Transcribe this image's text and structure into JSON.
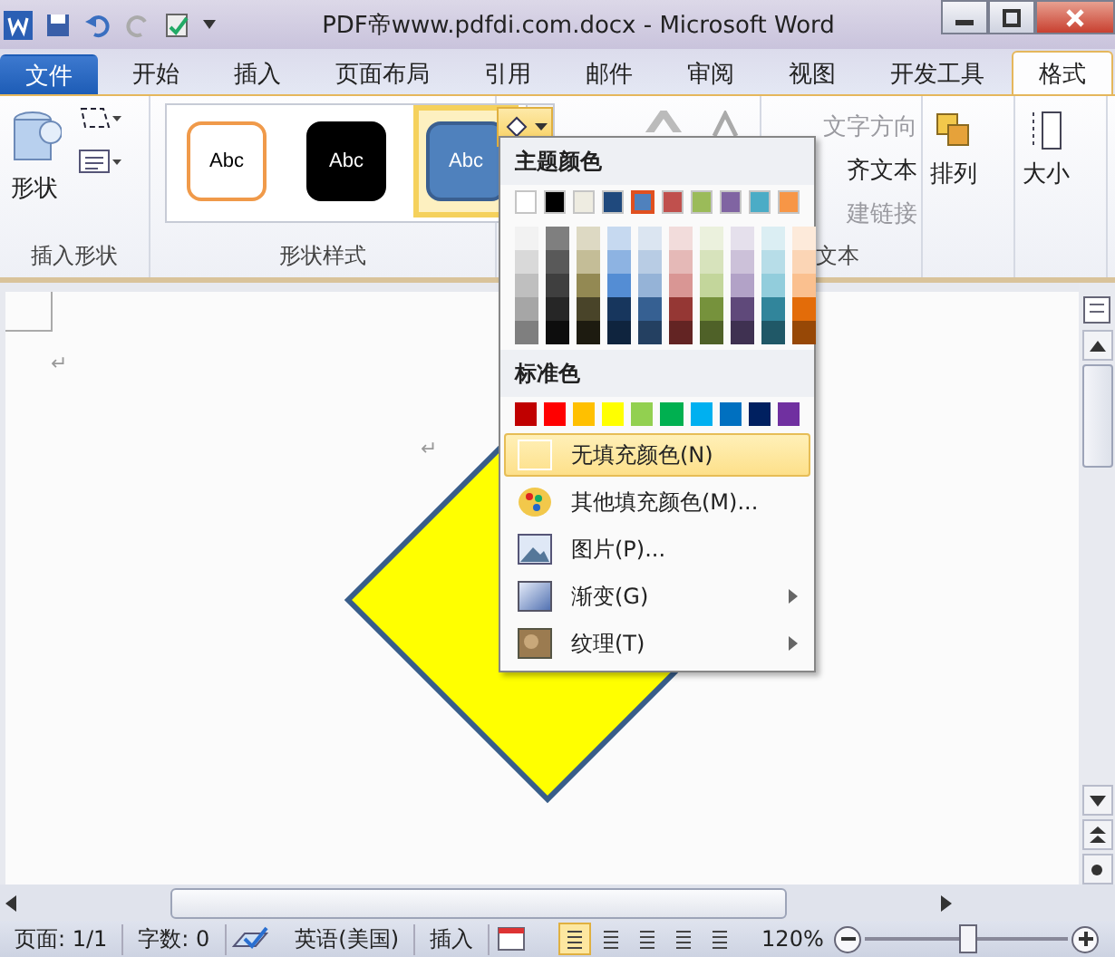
{
  "window": {
    "title": "PDF帝www.pdfdi.com.docx  -  Microsoft Word"
  },
  "tabs": [
    {
      "label": "文件",
      "kind": "file",
      "selected": false
    },
    {
      "label": "开始",
      "kind": "tab",
      "selected": false
    },
    {
      "label": "插入",
      "kind": "tab",
      "selected": false
    },
    {
      "label": "页面布局",
      "kind": "tab",
      "selected": false
    },
    {
      "label": "引用",
      "kind": "tab",
      "selected": false
    },
    {
      "label": "邮件",
      "kind": "tab",
      "selected": false
    },
    {
      "label": "审阅",
      "kind": "tab",
      "selected": false
    },
    {
      "label": "视图",
      "kind": "tab",
      "selected": false
    },
    {
      "label": "开发工具",
      "kind": "tab",
      "selected": false
    },
    {
      "label": "格式",
      "kind": "tab",
      "selected": true
    }
  ],
  "ribbon": {
    "insert_shapes": {
      "shape_button": "形状",
      "label": "插入形状"
    },
    "shape_styles": {
      "label": "形状样式",
      "styles": [
        {
          "label": "Abc",
          "kind": "outline",
          "selected": false
        },
        {
          "label": "Abc",
          "kind": "dark",
          "selected": false
        },
        {
          "label": "Abc",
          "kind": "blue",
          "selected": true
        }
      ]
    },
    "text_group": {
      "label": "文本",
      "items": [
        {
          "label": "文字方向",
          "disabled": true
        },
        {
          "label": "齐文本",
          "disabled": false
        },
        {
          "label": "建链接",
          "disabled": true
        }
      ]
    },
    "arrange": {
      "label": "排列"
    },
    "size": {
      "label": "大小"
    }
  },
  "document": {
    "paragraph_marks": [
      "↵",
      "↵"
    ]
  },
  "fill_menu": {
    "theme_heading": "主题颜色",
    "theme_colors": [
      {
        "color": "#ffffff",
        "selected": false,
        "shades": [
          {
            "color": "#f2f2f2"
          },
          {
            "color": "#d9d9d9"
          },
          {
            "color": "#bfbfbf"
          },
          {
            "color": "#a6a6a6"
          },
          {
            "color": "#7f7f7f"
          }
        ]
      },
      {
        "color": "#000000",
        "selected": false,
        "shades": [
          {
            "color": "#7f7f7f"
          },
          {
            "color": "#595959"
          },
          {
            "color": "#3f3f3f"
          },
          {
            "color": "#262626"
          },
          {
            "color": "#0d0d0d"
          }
        ]
      },
      {
        "color": "#eeece1",
        "selected": false,
        "shades": [
          {
            "color": "#ddd9c3"
          },
          {
            "color": "#c4bd97"
          },
          {
            "color": "#938953"
          },
          {
            "color": "#494429"
          },
          {
            "color": "#1d1b10"
          }
        ]
      },
      {
        "color": "#1f497d",
        "selected": false,
        "shades": [
          {
            "color": "#c6d9f0"
          },
          {
            "color": "#8db3e2"
          },
          {
            "color": "#548dd4"
          },
          {
            "color": "#17365d"
          },
          {
            "color": "#0f243e"
          }
        ]
      },
      {
        "color": "#4f81bd",
        "selected": true,
        "shades": [
          {
            "color": "#dbe5f1"
          },
          {
            "color": "#b8cce4"
          },
          {
            "color": "#95b3d7"
          },
          {
            "color": "#366092"
          },
          {
            "color": "#244061"
          }
        ]
      },
      {
        "color": "#c0504d",
        "selected": false,
        "shades": [
          {
            "color": "#f2dcdb"
          },
          {
            "color": "#e5b9b7"
          },
          {
            "color": "#d99694"
          },
          {
            "color": "#953734"
          },
          {
            "color": "#632423"
          }
        ]
      },
      {
        "color": "#9bbb59",
        "selected": false,
        "shades": [
          {
            "color": "#ebf1dd"
          },
          {
            "color": "#d7e3bc"
          },
          {
            "color": "#c3d69b"
          },
          {
            "color": "#76923c"
          },
          {
            "color": "#4f6128"
          }
        ]
      },
      {
        "color": "#8064a2",
        "selected": false,
        "shades": [
          {
            "color": "#e5e0ec"
          },
          {
            "color": "#ccc1d9"
          },
          {
            "color": "#b2a2c7"
          },
          {
            "color": "#5f497a"
          },
          {
            "color": "#3f3151"
          }
        ]
      },
      {
        "color": "#4bacc6",
        "selected": false,
        "shades": [
          {
            "color": "#dbeef3"
          },
          {
            "color": "#b7dde8"
          },
          {
            "color": "#92cddc"
          },
          {
            "color": "#31859b"
          },
          {
            "color": "#205867"
          }
        ]
      },
      {
        "color": "#f79646",
        "selected": false,
        "shades": [
          {
            "color": "#fdeada"
          },
          {
            "color": "#fbd5b5"
          },
          {
            "color": "#fac08f"
          },
          {
            "color": "#e36c09"
          },
          {
            "color": "#974806"
          }
        ]
      }
    ],
    "standard_heading": "标准色",
    "standard_colors": [
      {
        "color": "#c00000"
      },
      {
        "color": "#ff0000"
      },
      {
        "color": "#ffc000"
      },
      {
        "color": "#ffff00"
      },
      {
        "color": "#92d050"
      },
      {
        "color": "#00b050"
      },
      {
        "color": "#00b0f0"
      },
      {
        "color": "#0070c0"
      },
      {
        "color": "#002060"
      },
      {
        "color": "#7030a0"
      }
    ],
    "items": [
      {
        "label": "无填充颜色(N)",
        "kind": "no-fill",
        "selected": true,
        "submenu": false
      },
      {
        "label": "其他填充颜色(M)...",
        "kind": "palette",
        "selected": false,
        "submenu": false
      },
      {
        "label": "图片(P)...",
        "kind": "picture",
        "selected": false,
        "submenu": false
      },
      {
        "label": "渐变(G)",
        "kind": "gradient",
        "selected": false,
        "submenu": true
      },
      {
        "label": "纹理(T)",
        "kind": "texture",
        "selected": false,
        "submenu": true
      }
    ]
  },
  "status_bar": {
    "page": "页面: 1/1",
    "words": "字数: 0",
    "language": "英语(美国)",
    "mode": "插入",
    "zoom": "120%",
    "zoom_slider": {
      "level": 0.5
    }
  }
}
